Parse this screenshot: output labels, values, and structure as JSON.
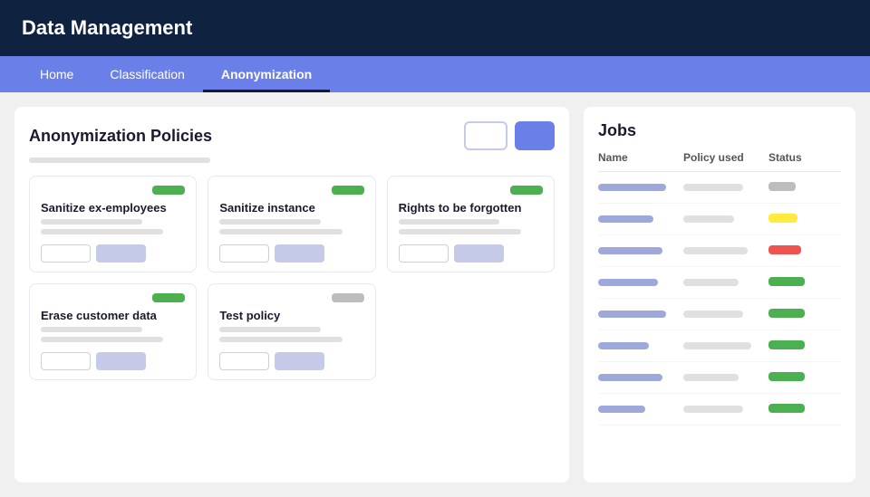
{
  "header": {
    "title": "Data Management"
  },
  "nav": {
    "items": [
      {
        "label": "Home",
        "active": false
      },
      {
        "label": "Classification",
        "active": false
      },
      {
        "label": "Anonymization",
        "active": true
      }
    ]
  },
  "policies_panel": {
    "title": "Anonymization Policies",
    "btn_outline_label": "",
    "btn_filled_label": "",
    "cards": [
      {
        "id": "sanitize-ex-employees",
        "title": "Sanitize ex-employees",
        "active": true
      },
      {
        "id": "sanitize-instance",
        "title": "Sanitize instance",
        "active": true
      },
      {
        "id": "rights-to-be-forgotten",
        "title": "Rights to be forgotten",
        "active": true
      },
      {
        "id": "erase-customer-data",
        "title": "Erase customer data",
        "active": true
      },
      {
        "id": "test-policy",
        "title": "Test policy",
        "active": false
      }
    ]
  },
  "jobs_panel": {
    "title": "Jobs",
    "columns": [
      "Name",
      "Policy used",
      "Status"
    ],
    "rows": [
      {
        "name_width": "80",
        "policy_width": "70",
        "status": "gray"
      },
      {
        "name_width": "65",
        "policy_width": "60",
        "status": "yellow"
      },
      {
        "name_width": "75",
        "policy_width": "75",
        "status": "red"
      },
      {
        "name_width": "70",
        "policy_width": "65",
        "status": "green"
      },
      {
        "name_width": "80",
        "policy_width": "70",
        "status": "green"
      },
      {
        "name_width": "60",
        "policy_width": "80",
        "status": "green"
      },
      {
        "name_width": "75",
        "policy_width": "65",
        "status": "green"
      },
      {
        "name_width": "55",
        "policy_width": "70",
        "status": "green"
      }
    ]
  }
}
